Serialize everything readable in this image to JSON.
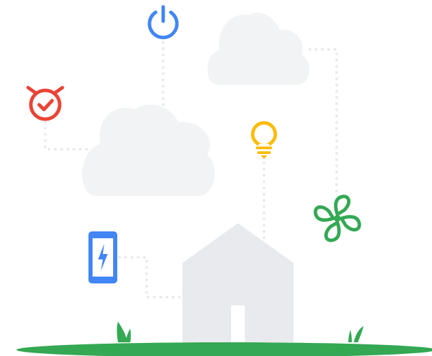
{
  "illustration": {
    "colors": {
      "background": "#ffffff",
      "cloud": "#f1f3f4",
      "house": "#e8eaed",
      "door": "#ffffff",
      "connector": "#e8eaed",
      "ground": "#34a853",
      "grass": "#34a853",
      "power": "#4285f4",
      "alarm": "#ea4335",
      "bulb": "#fbbc04",
      "fan": "#34a853",
      "phone": "#4285f4"
    },
    "elements": [
      {
        "name": "cloud-top-right",
        "kind": "cloud"
      },
      {
        "name": "cloud-center",
        "kind": "cloud"
      },
      {
        "name": "house",
        "kind": "house"
      },
      {
        "name": "ground",
        "kind": "ground"
      },
      {
        "name": "power-icon",
        "kind": "icon"
      },
      {
        "name": "alarm-clock-icon",
        "kind": "icon"
      },
      {
        "name": "light-bulb-icon",
        "kind": "icon"
      },
      {
        "name": "fan-icon",
        "kind": "icon"
      },
      {
        "name": "phone-charging-icon",
        "kind": "icon"
      }
    ]
  }
}
